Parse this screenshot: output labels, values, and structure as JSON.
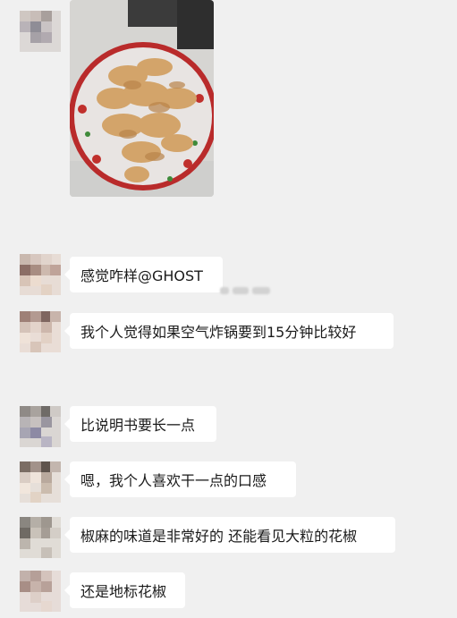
{
  "chat": {
    "messages": [
      {
        "type": "image",
        "alt": ""
      },
      {
        "type": "text",
        "text": "感觉咋样@GHOST"
      },
      {
        "type": "text",
        "text": "我个人觉得如果空气炸锅要到15分钟比较好"
      },
      {
        "type": "text",
        "text": "比说明书要长一点"
      },
      {
        "type": "text",
        "text": "嗯，我个人喜欢干一点的口感"
      },
      {
        "type": "text",
        "text": "椒麻的味道是非常好的 还能看见大粒的花椒"
      },
      {
        "type": "text",
        "text": "还是地标花椒"
      }
    ]
  },
  "colors": {
    "background": "#f0f0f0",
    "bubble": "#ffffff",
    "text": "#1a1a1a"
  }
}
